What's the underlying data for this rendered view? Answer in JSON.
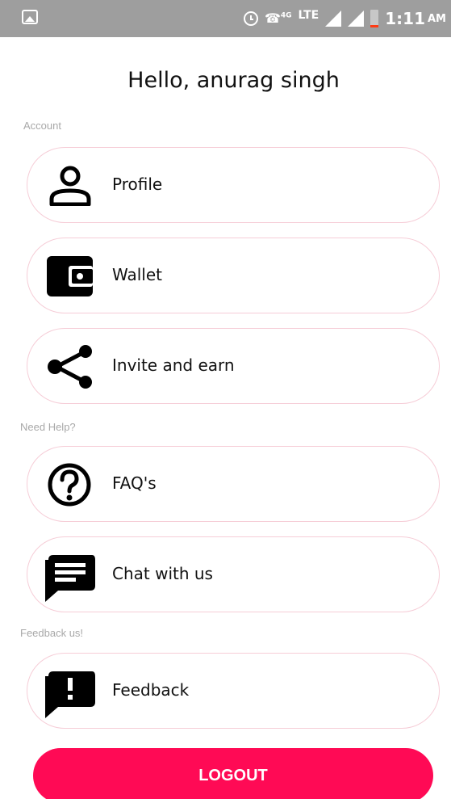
{
  "status_bar": {
    "network_type": "4G",
    "lte": "LTE",
    "time": "1:11",
    "ampm": "AM",
    "icons": [
      "gallery-icon",
      "alarm-icon",
      "volte-call-icon",
      "signal-icon",
      "signal-icon",
      "battery-icon"
    ]
  },
  "greeting": "Hello, anurag singh",
  "sections": {
    "account": "Account",
    "help": "Need Help?",
    "feedback": "Feedback us!"
  },
  "menu": {
    "profile": {
      "label": "Profile",
      "icon": "person-icon"
    },
    "wallet": {
      "label": "Wallet",
      "icon": "wallet-icon"
    },
    "invite": {
      "label": "Invite and earn",
      "icon": "share-icon"
    },
    "faq": {
      "label": "FAQ's",
      "icon": "help-circle-icon"
    },
    "chat": {
      "label": "Chat with us",
      "icon": "chat-icon"
    },
    "feedback": {
      "label": "Feedback",
      "icon": "feedback-icon"
    }
  },
  "logout_label": "LOGOUT",
  "colors": {
    "accent": "#ff0a55",
    "card_border": "#f6cdd7",
    "status_bar": "#9e9e9e"
  }
}
